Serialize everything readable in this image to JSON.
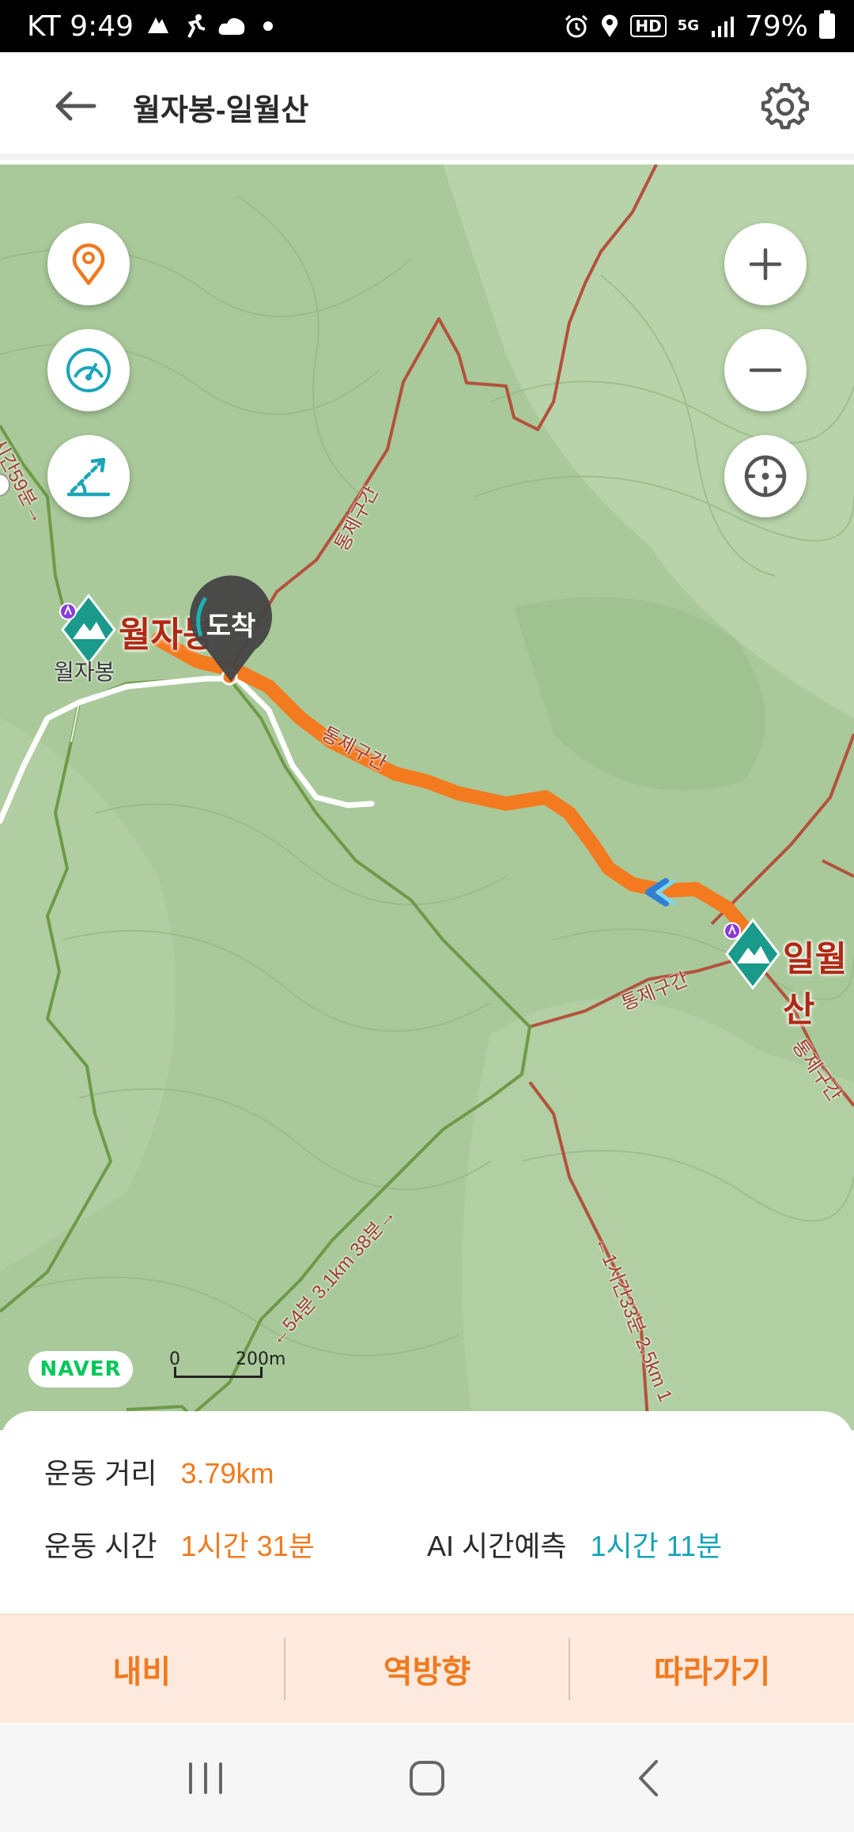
{
  "status_bar": {
    "carrier_time": "KT 9:49",
    "battery": "79%",
    "network_hd": "HD",
    "network_5g": "5G"
  },
  "header": {
    "title": "월자봉-일월산",
    "back_icon": "arrow-left-icon",
    "settings_icon": "gear-icon"
  },
  "map": {
    "controls_left": [
      "location-pin-icon",
      "speedometer-icon",
      "slope-icon"
    ],
    "controls_right": [
      "zoom-in-icon",
      "zoom-out-icon",
      "crosshair-icon"
    ],
    "arrival_marker": "도착",
    "peaks": [
      {
        "label": "월자봉",
        "sublabel": "월자봉"
      },
      {
        "label": "일월산"
      }
    ],
    "trail_labels": [
      "통제구간",
      "통제구간",
      "통제구간",
      "통제구간"
    ],
    "route_labels": [
      "시간59분→",
      "←54분 3.1km 38분→",
      "←1시간33분 2.5km 1"
    ],
    "naver_logo": "NAVER",
    "scale_zero": "0",
    "scale_max": "200m",
    "colors": {
      "route": "#f47a20",
      "trail_red": "#b4513c",
      "trail_green": "#6e9a48",
      "terrain": "#a9c99a"
    }
  },
  "info": {
    "distance_label": "운동 거리",
    "distance_value": "3.79km",
    "time_label": "운동 시간",
    "time_value": "1시간 31분",
    "ai_label": "AI 시간예측",
    "ai_value": "1시간 11분"
  },
  "actions": {
    "navi": "내비",
    "reverse": "역방향",
    "follow": "따라가기"
  },
  "nav_bar": [
    "recent-apps-icon",
    "home-icon",
    "back-icon"
  ]
}
